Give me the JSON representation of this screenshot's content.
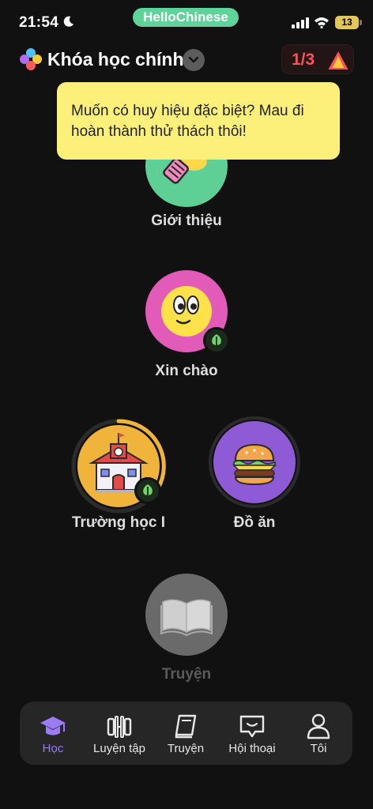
{
  "status_bar": {
    "time": "21:54",
    "app_name": "HelloChinese",
    "battery": "13"
  },
  "header": {
    "course_title": "Khóa học chính",
    "progress": "1/3"
  },
  "tooltip": {
    "text": "Muốn có huy hiệu đặc biệt? Mau đi hoàn thành thử thách thôi!"
  },
  "lessons": [
    {
      "label": "Giới thiệu",
      "color": "#5ecf95"
    },
    {
      "label": "Xin chào",
      "color": "#e35bb8"
    },
    {
      "label": "Trường học I",
      "color": "#f0b43a"
    },
    {
      "label": "Đồ ăn",
      "color": "#8e5ad6"
    },
    {
      "label": "Truyện",
      "color": "#6a6a6a"
    }
  ],
  "bottom_nav": [
    {
      "label": "Học",
      "icon": "graduation-cap-icon",
      "active": true
    },
    {
      "label": "Luyện tập",
      "icon": "dumbbell-icon",
      "active": false
    },
    {
      "label": "Truyện",
      "icon": "book-icon",
      "active": false
    },
    {
      "label": "Hội thoại",
      "icon": "chat-bubble-icon",
      "active": false
    },
    {
      "label": "Tôi",
      "icon": "person-icon",
      "active": false
    }
  ],
  "colors": {
    "accent": "#9b7cf5",
    "tooltip_bg": "#fdf07a",
    "progress_red": "#ff4f57"
  }
}
